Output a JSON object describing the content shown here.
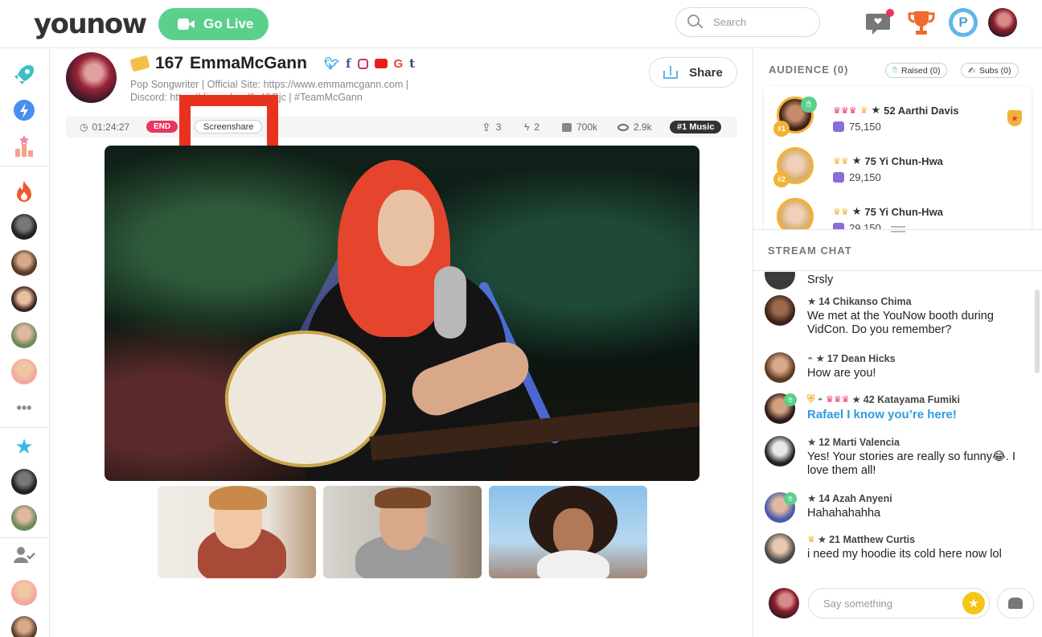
{
  "app": {
    "logo": "younow",
    "go_live_label": "Go Live",
    "search_placeholder": "Search",
    "notification_color": "#e8365d",
    "accent_green": "#5bd08a"
  },
  "profile": {
    "level": "167",
    "name": "EmmaMcGann",
    "bio_line1": "Pop Songwriter | Official Site: https://www.emmamcgann.com |",
    "bio_line2": "Discord: https://discord.gg/6s49Gjc | #TeamMcGann",
    "share_label": "Share",
    "socials": [
      "twitter-icon",
      "facebook-icon",
      "instagram-icon",
      "youtube-icon",
      "google-icon",
      "tumblr-icon"
    ]
  },
  "stats": {
    "duration": "01:24:27",
    "end_label": "END",
    "screenshare_label": "Screenshare",
    "shares": "3",
    "boosts": "2",
    "likes": "700k",
    "viewers": "2.9k",
    "tag": "#1 Music"
  },
  "audience": {
    "title": "AUDIENCE (0)",
    "raised_label": "Raised (0)",
    "subs_label": "Subs (0)",
    "members": [
      {
        "rank": "#1",
        "level_name": "52 Aarthi Davis",
        "likes": "75,150"
      },
      {
        "rank": "#2",
        "level_name": "75 Yi Chun-Hwa",
        "likes": "29,150"
      },
      {
        "rank": "",
        "level_name": "75 Yi Chun-Hwa",
        "likes": "29,150"
      }
    ]
  },
  "chat": {
    "title": "STREAM CHAT",
    "messages": [
      {
        "name": "",
        "text": "Srsly"
      },
      {
        "name": "14 Chikanso Chima",
        "text": "We met at the YouNow booth during VidCon. Do you remember?"
      },
      {
        "name": "17 Dean Hicks",
        "text": "How are you!"
      },
      {
        "name": "42 Katayama Fumiki",
        "text": "Rafael I know you’re here!"
      },
      {
        "name": "12 Marti Valencia",
        "text": "Yes! Your stories are really so funny😂. I love them all!"
      },
      {
        "name": "14 Azah Anyeni",
        "text": "Hahahahahha"
      },
      {
        "name": "21 Matthew Curtis",
        "text": "i need my hoodie its cold here now lol"
      }
    ],
    "input_placeholder": "Say something"
  }
}
